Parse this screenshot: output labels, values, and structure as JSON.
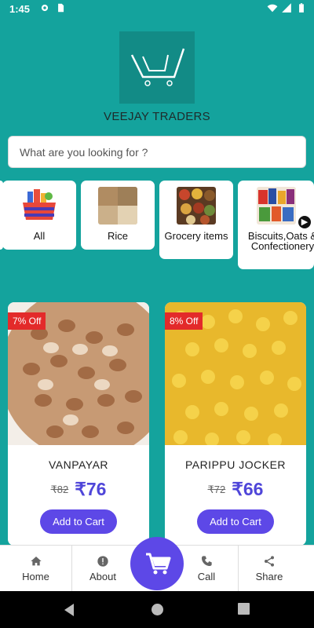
{
  "status_bar": {
    "time": "1:45",
    "icons": [
      "settings-icon",
      "sd-card-icon",
      "wifi-icon",
      "signal-icon",
      "battery-icon"
    ]
  },
  "brand": {
    "name": "VEEJAY TRADERS",
    "logo_icon": "cart-logo-icon"
  },
  "search": {
    "placeholder": "What are you looking for ?",
    "value": ""
  },
  "categories": [
    {
      "label": "All",
      "icon": "basket-icon"
    },
    {
      "label": "Rice",
      "icon": "rice-image"
    },
    {
      "label": "Grocery items",
      "icon": "spices-image"
    },
    {
      "label": "Biscuits,Oats & Confectionery",
      "icon": "biscuits-image"
    }
  ],
  "products": [
    {
      "name": "VANPAYAR",
      "discount": "7% Off",
      "old_price": "₹82",
      "new_price": "₹76",
      "cart_label": "Add to Cart"
    },
    {
      "name": "PARIPPU JOCKER",
      "discount": "8% Off",
      "old_price": "₹72",
      "new_price": "₹66",
      "cart_label": "Add to Cart"
    }
  ],
  "bottom_nav": {
    "home": "Home",
    "about": "About",
    "call": "Call",
    "share": "Share"
  },
  "colors": {
    "background": "#14a39d",
    "accent": "#5d48e7",
    "price": "#4f46d9",
    "badge": "#e32a2a"
  }
}
